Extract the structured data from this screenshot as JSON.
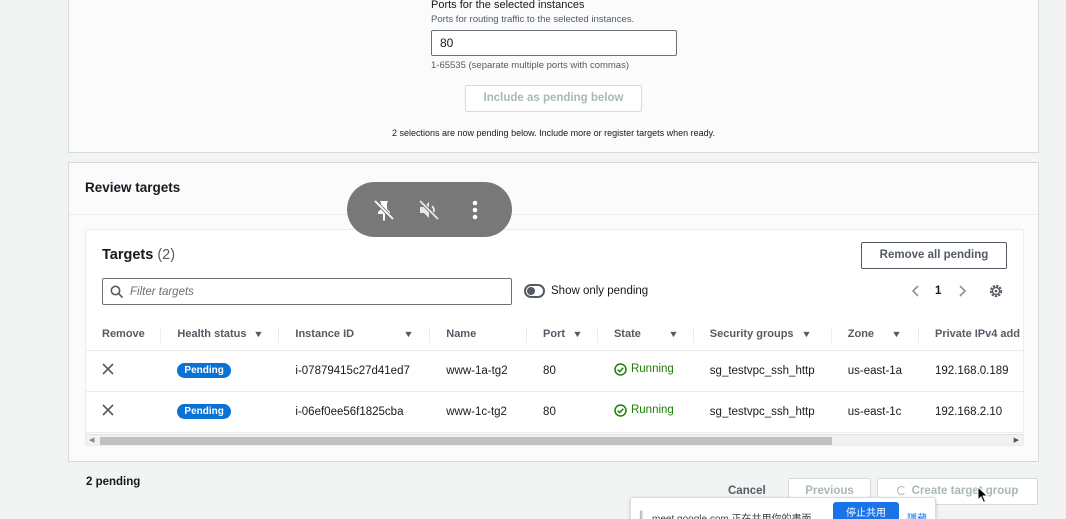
{
  "ports_section": {
    "label": "Ports for the selected instances",
    "description": "Ports for routing traffic to the selected instances.",
    "value": "80",
    "hint": "1-65535 (separate multiple ports with commas)",
    "include_button": "Include as pending below",
    "pending_note": "2 selections are now pending below. Include more or register targets when ready."
  },
  "review": {
    "title": "Review targets",
    "targets_title": "Targets",
    "targets_count": "(2)",
    "remove_all_button": "Remove all pending",
    "filter_placeholder": "Filter targets",
    "toggle_label": "Show only pending",
    "page_number": "1",
    "columns": [
      "Remove",
      "Health status",
      "Instance ID",
      "Name",
      "Port",
      "State",
      "Security groups",
      "Zone",
      "Private IPv4 add"
    ],
    "rows": [
      {
        "health": "Pending",
        "instance_id": "i-07879415c27d41ed7",
        "name": "www-1a-tg2",
        "port": "80",
        "state": "Running",
        "security_group": "sg_testvpc_ssh_http",
        "zone": "us-east-1a",
        "ipv4": "192.168.0.189"
      },
      {
        "health": "Pending",
        "instance_id": "i-06ef0ee56f1825cba",
        "name": "www-1c-tg2",
        "port": "80",
        "state": "Running",
        "security_group": "sg_testvpc_ssh_http",
        "zone": "us-east-1c",
        "ipv4": "192.168.2.10"
      }
    ]
  },
  "footer": {
    "pending_count": "2 pending",
    "cancel": "Cancel",
    "previous": "Previous",
    "create": "Create target group"
  },
  "meet": {
    "controls": [
      "pin-off-icon",
      "volume-off-icon",
      "more-vert-icon"
    ],
    "share_text": "meet.google.com 正在共用你的畫面。",
    "stop_button": "停止共用",
    "hide_link": "隱藏"
  },
  "colors": {
    "accent": "#0972d3",
    "running": "#1d8102",
    "disabled_text": "#aab7b8",
    "meet_blue": "#1a73e8"
  }
}
